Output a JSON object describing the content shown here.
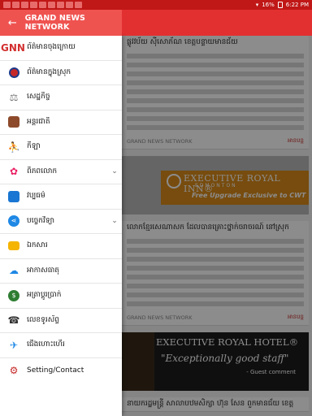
{
  "status_bar": {
    "time": "6:22 PM",
    "battery": "16%"
  },
  "app_title": "GRAND NEWS NETWORK",
  "menu": [
    {
      "label": "ព័ត៌មានចុងក្រោយ",
      "icon": "gnn-logo-icon",
      "logo_text": "GNN",
      "expandable": false
    },
    {
      "label": "ព័ត៌មានក្នុងស្រុក",
      "icon": "cambodia-icon",
      "expandable": false
    },
    {
      "label": "សេដ្ឋកិច្ច",
      "icon": "scale-icon",
      "expandable": false
    },
    {
      "label": "អន្តរជាតិ",
      "icon": "books-icon",
      "expandable": false
    },
    {
      "label": "កីឡា",
      "icon": "sports-icon",
      "expandable": false
    },
    {
      "label": "ពិភពលោក",
      "icon": "globe-icon",
      "expandable": true
    },
    {
      "label": "វប្បធម៌",
      "icon": "media-icon",
      "expandable": false
    },
    {
      "label": "បច្ចេកវិទ្យា",
      "icon": "share-icon",
      "expandable": true
    },
    {
      "label": "ឯកសារ",
      "icon": "folder-icon",
      "expandable": false
    },
    {
      "label": "អាកាសធាតុ",
      "icon": "cloud-icon",
      "expandable": false
    },
    {
      "label": "អត្រាប្តូរប្រាក់",
      "icon": "exchange-icon",
      "expandable": false
    },
    {
      "label": "លេខទូរស័ព្ទ",
      "icon": "phone-icon",
      "expandable": false
    },
    {
      "label": "ជើងហោះហើរ",
      "icon": "airplane-icon",
      "expandable": false
    },
    {
      "label": "Setting/Contact",
      "icon": "settings-icon",
      "expandable": false
    }
  ],
  "content": {
    "article1_title": "ផ្លូវវប័យ ស៊ីសោភ័ណ ខេត្តបន្ទាយមានជ័យ",
    "source": "GRAND NEWS NETWORK",
    "more": "អានបន្ត",
    "ad1": {
      "line1": "EXECUTIVE ROYAL INN®",
      "line2": "EDMONTON",
      "line3": "Free Upgrade Exclusive to CWT"
    },
    "article2_title": "លោកខ្មែរសេណាសក ដែលបានគ្រោះថ្នាក់ចរាចរណ៍ នៅស្រុក",
    "ad2": {
      "line1": "EXECUTIVE ROYAL HOTEL®",
      "line2": "\"Exceptionally good staff\"",
      "line3": "- Guest comment"
    },
    "article3_title": "នាយករដ្ឋមន្ត្រី សាលាបឋមសិក្សា ហ៊ុន សែន ពួកមានជ័យ ខេត្ត"
  },
  "colors": {
    "status_bar": "#c01717",
    "app_bar": "#e23030",
    "drawer_header": "#ef5350",
    "accent": "#c62828"
  }
}
